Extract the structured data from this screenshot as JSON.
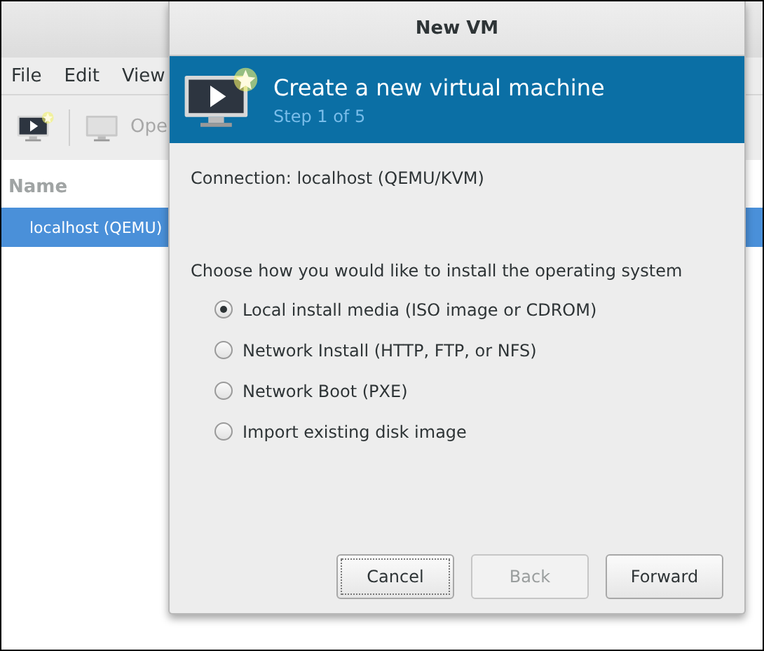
{
  "app": {
    "menu": [
      "File",
      "Edit",
      "View"
    ],
    "toolbar": [
      {
        "kind": "new",
        "disabled": false
      },
      {
        "kind": "open",
        "label": "Ope",
        "disabled": true
      }
    ],
    "list": {
      "header": "Name",
      "rows": [
        {
          "label": "localhost (QEMU)",
          "selected": true
        }
      ]
    }
  },
  "dialog": {
    "title": "New VM",
    "heading": "Create a new virtual machine",
    "step": "Step 1 of 5",
    "connection": "Connection: localhost (QEMU/KVM)",
    "prompt": "Choose how you would like to install the operating system",
    "options": [
      {
        "label": "Local install media (ISO image or CDROM)",
        "selected": true
      },
      {
        "label": "Network Install (HTTP, FTP, or NFS)",
        "selected": false
      },
      {
        "label": "Network Boot (PXE)",
        "selected": false
      },
      {
        "label": "Import existing disk image",
        "selected": false
      }
    ],
    "buttons": [
      {
        "label": "Cancel",
        "disabled": false,
        "focused": true
      },
      {
        "label": "Back",
        "disabled": true,
        "focused": false
      },
      {
        "label": "Forward",
        "disabled": false,
        "focused": false
      }
    ]
  }
}
